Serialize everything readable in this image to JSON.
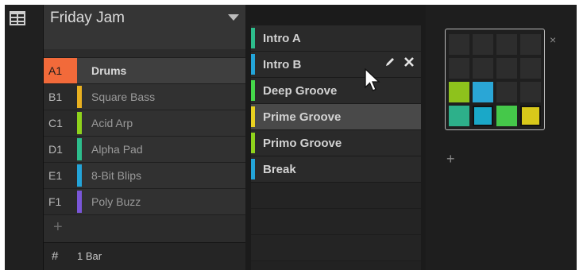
{
  "colors": {
    "selected_slot": "#f26a3a"
  },
  "group": {
    "title": "Friday Jam",
    "items": [
      {
        "slot": "A1",
        "name": "Drums",
        "color": "#f26a3a",
        "selected": true
      },
      {
        "slot": "B1",
        "name": "Square Bass",
        "color": "#e8b020",
        "selected": false
      },
      {
        "slot": "C1",
        "name": "Acid Arp",
        "color": "#8fd21c",
        "selected": false
      },
      {
        "slot": "D1",
        "name": "Alpha Pad",
        "color": "#2dbd8c",
        "selected": false
      },
      {
        "slot": "E1",
        "name": "8-Bit Blips",
        "color": "#23a4d8",
        "selected": false
      },
      {
        "slot": "F1",
        "name": "Poly Buzz",
        "color": "#7a56d8",
        "selected": false
      }
    ],
    "add_label": "+",
    "footer_icon": "#",
    "footer_length": "1 Bar"
  },
  "scenes": {
    "items": [
      {
        "name": "Intro A",
        "color": "#2dbd8c",
        "selected": false
      },
      {
        "name": "Intro B",
        "color": "#23a4d8",
        "selected": false,
        "hovered": true
      },
      {
        "name": "Deep Groove",
        "color": "#45d84a",
        "selected": false
      },
      {
        "name": "Prime Groove",
        "color": "#e8d020",
        "selected": true
      },
      {
        "name": "Primo Groove",
        "color": "#8fd21c",
        "selected": false
      },
      {
        "name": "Break",
        "color": "#23a4d8",
        "selected": false
      }
    ]
  },
  "pads": {
    "close_label": "×",
    "add_label": "+",
    "cells": [
      {
        "col": 0,
        "row": 2,
        "color": "#8ec21c"
      },
      {
        "col": 1,
        "row": 2,
        "color": "#2aa6d6"
      },
      {
        "col": 0,
        "row": 3,
        "color": "#2db08a"
      },
      {
        "col": 1,
        "row": 3,
        "color": "#1aa8c8",
        "outlined": true
      },
      {
        "col": 2,
        "row": 3,
        "color": "#45c84a"
      },
      {
        "col": 3,
        "row": 3,
        "color": "#d8c81a",
        "outlined": true
      }
    ]
  }
}
